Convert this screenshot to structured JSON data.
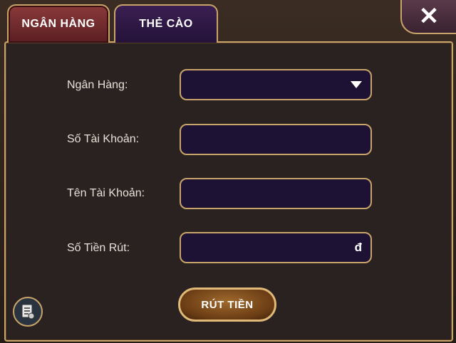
{
  "tabs": [
    {
      "label": "NGÂN HÀNG",
      "active": true
    },
    {
      "label": "THẺ CÀO",
      "active": false
    }
  ],
  "close": {
    "icon": "close-icon",
    "glyph": "✕"
  },
  "form": {
    "bank_label": "Ngân Hàng:",
    "account_number_label": "Số Tài Khoản:",
    "account_name_label": "Tên Tài Khoản:",
    "amount_label": "Số Tiền Rút:",
    "amount_suffix": "đ"
  },
  "withdraw_button": {
    "label": "RÚT TIỀN"
  },
  "history_button": {
    "icon": "history-document-icon"
  },
  "colors": {
    "gold_border": "#c9a46a",
    "field_bg": "#1e1234",
    "active_tab": "#8a3a3a",
    "inactive_tab": "#3a1f52"
  }
}
